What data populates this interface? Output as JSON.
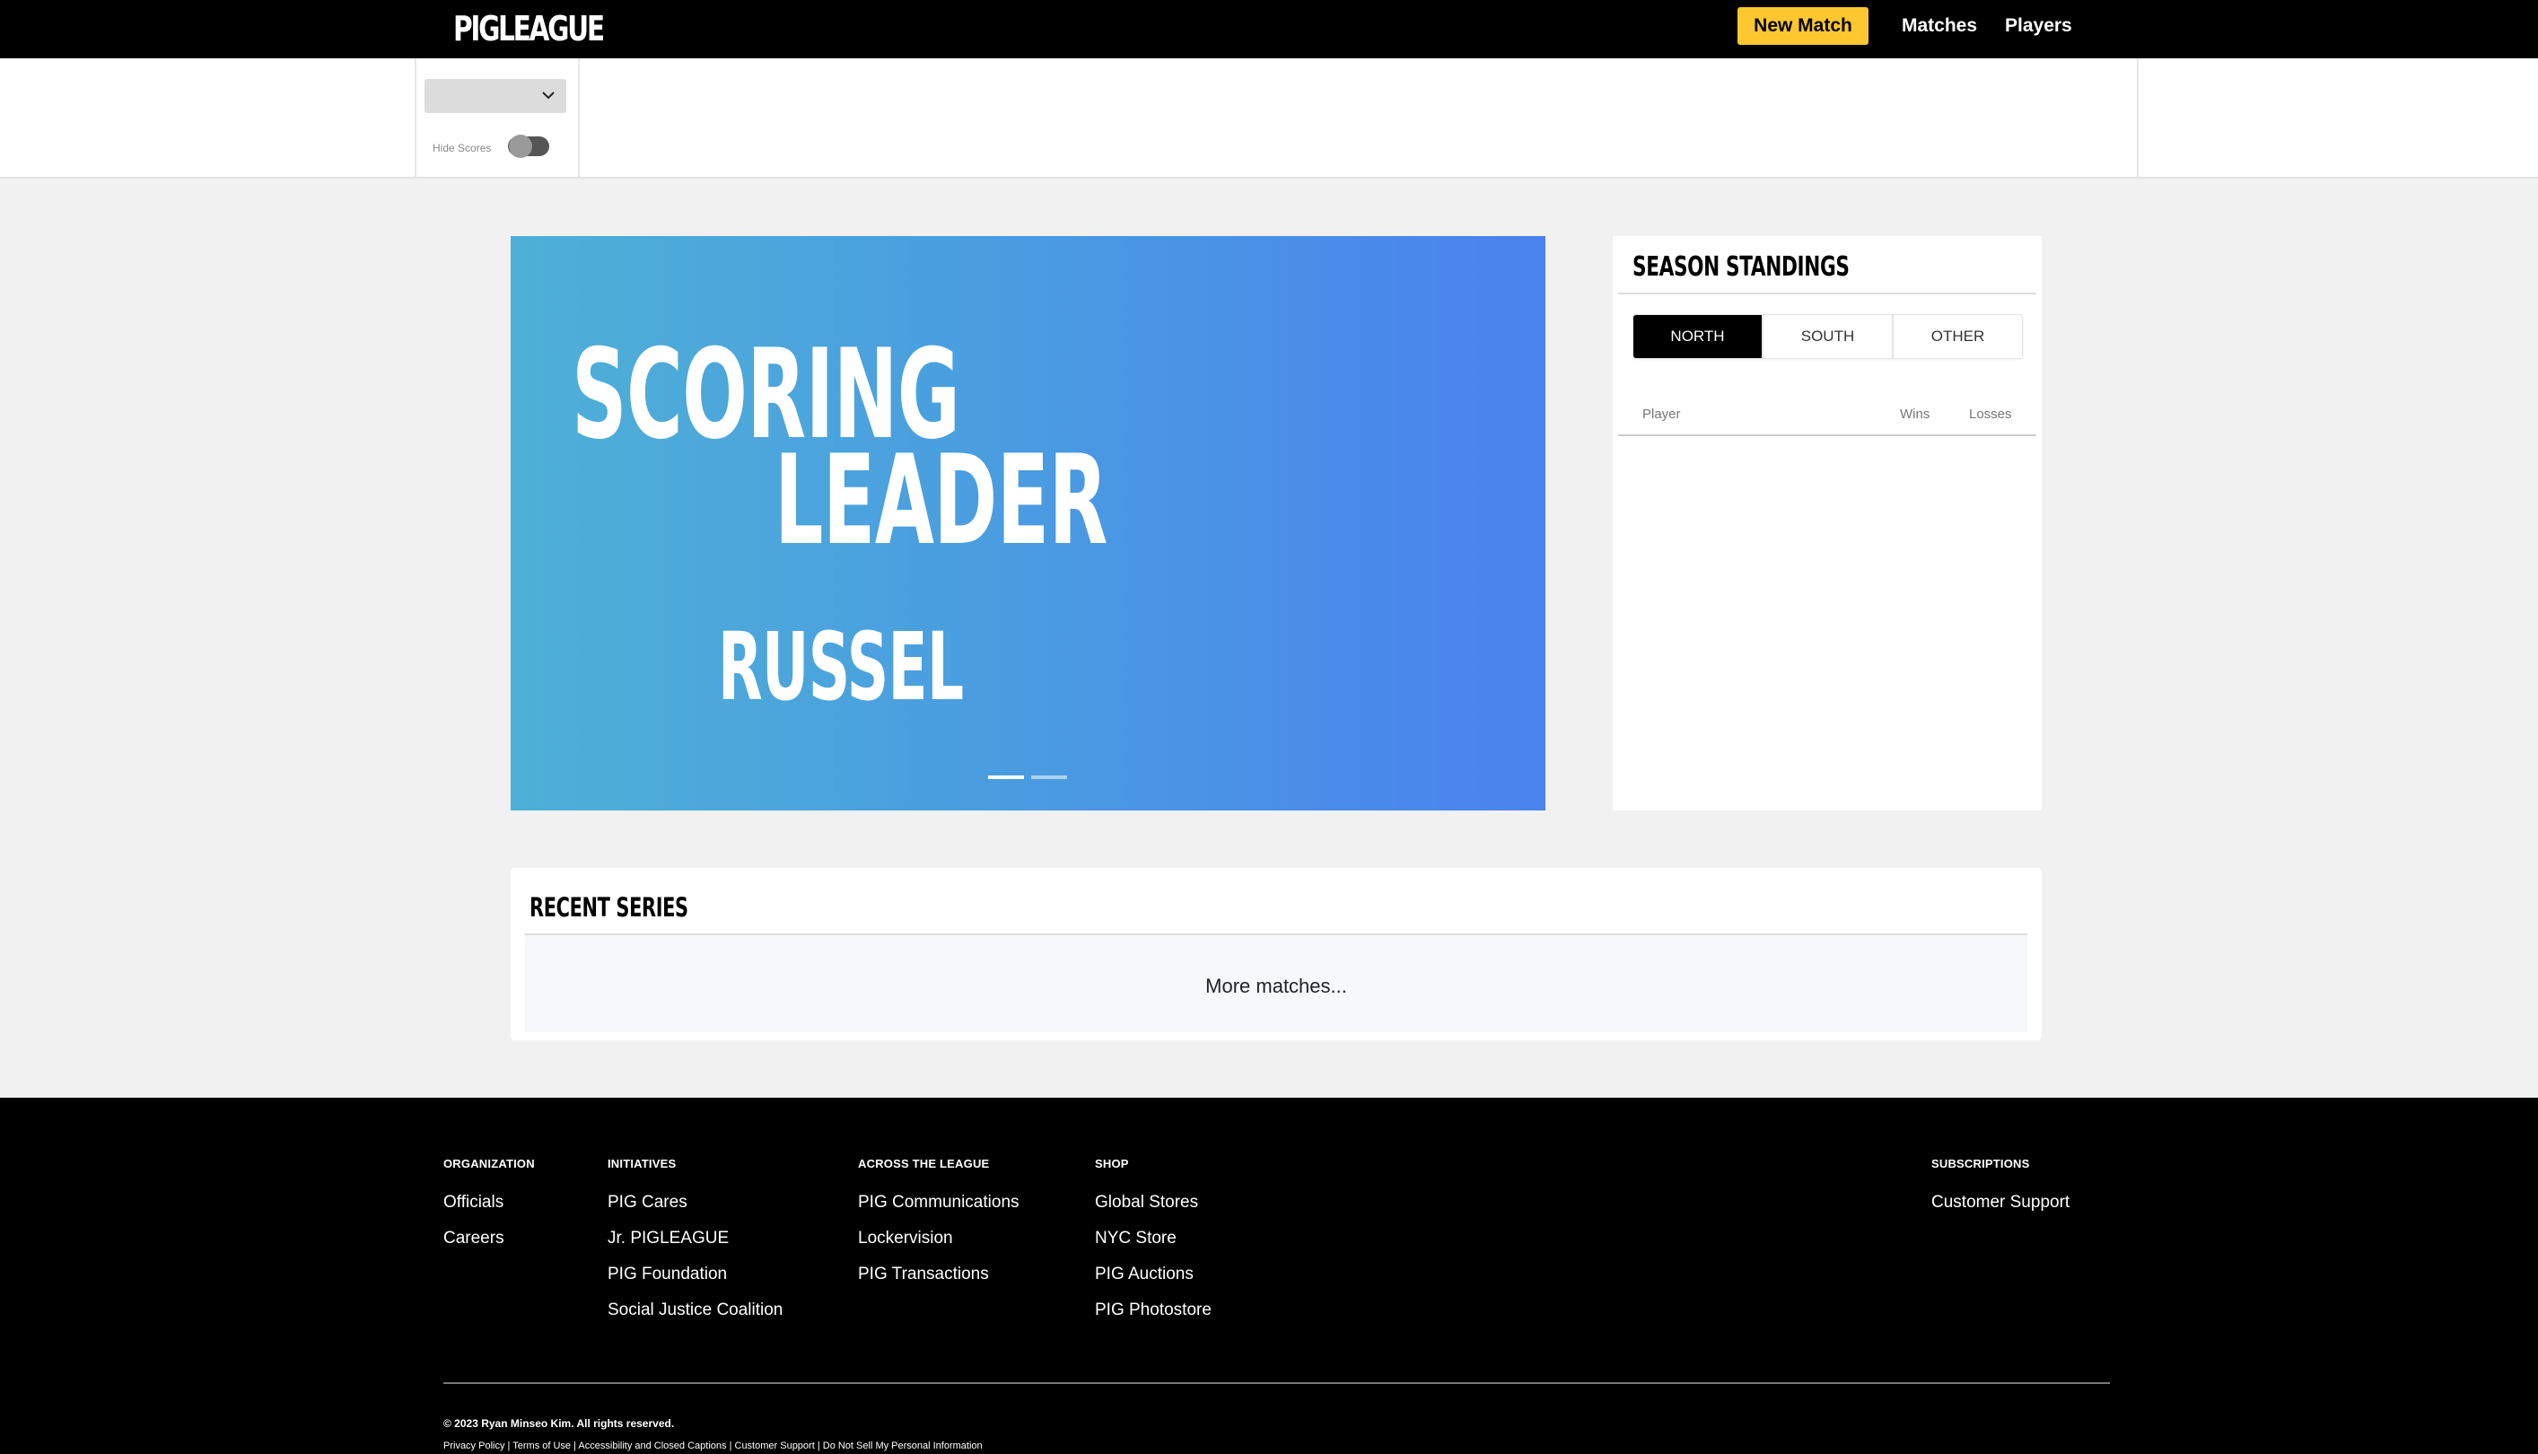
{
  "header": {
    "logo": "PIGLEAGUE",
    "new_match_label": "New Match",
    "nav": {
      "matches": "Matches",
      "players": "Players"
    },
    "accent_color": "#fdc72f"
  },
  "filters": {
    "select_value": "",
    "hide_scores_label": "Hide Scores",
    "hide_scores_on": false
  },
  "hero": {
    "line1": "SCORING",
    "line2": "LEADER",
    "player": "RUSSEL",
    "slide_count": 2,
    "active_slide": 1
  },
  "standings": {
    "title": "SEASON STANDINGS",
    "tabs": [
      "NORTH",
      "SOUTH",
      "OTHER"
    ],
    "active_tab": "NORTH",
    "columns": {
      "player": "Player",
      "wins": "Wins",
      "losses": "Losses"
    },
    "rows": []
  },
  "recent": {
    "title": "RECENT SERIES",
    "more_label": "More matches..."
  },
  "footer": {
    "columns": [
      {
        "heading": "ORGANIZATION",
        "links": [
          "Officials",
          "Careers"
        ]
      },
      {
        "heading": "INITIATIVES",
        "links": [
          "PIG Cares",
          "Jr. PIGLEAGUE",
          "PIG Foundation",
          "Social Justice Coalition"
        ]
      },
      {
        "heading": "ACROSS THE LEAGUE",
        "links": [
          "PIG Communications",
          "Lockervision",
          "PIG Transactions"
        ]
      },
      {
        "heading": "SHOP",
        "links": [
          "Global Stores",
          "NYC Store",
          "PIG Auctions",
          "PIG Photostore"
        ]
      },
      {
        "heading": "SUBSCRIPTIONS",
        "links": [
          "Customer Support"
        ]
      }
    ],
    "copyright": "© 2023 Ryan Minseo Kim. All rights reserved.",
    "legal_links": [
      "Privacy Policy",
      "Terms of Use",
      "Accessibility and Closed Captions",
      "Customer Support",
      "Do Not Sell My Personal Information"
    ]
  }
}
